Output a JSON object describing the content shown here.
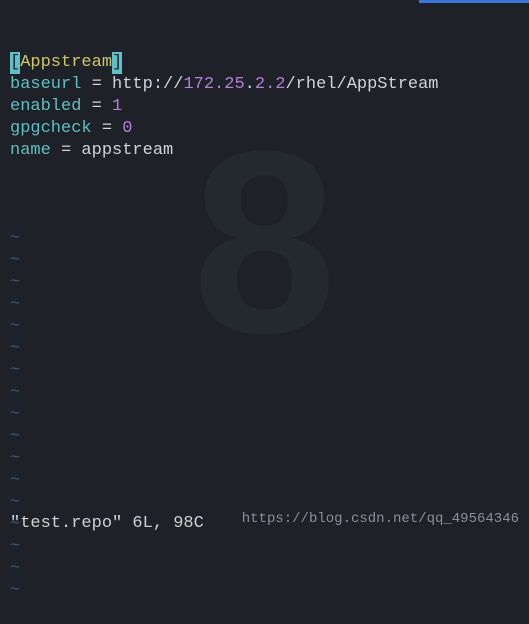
{
  "editor": {
    "lines": [
      {
        "parts": [
          {
            "cls": "cursor-block",
            "text": "["
          },
          {
            "cls": "yellow",
            "text": "Appstream"
          },
          {
            "cls": "cursor-block",
            "text": "]"
          }
        ]
      },
      {
        "parts": [
          {
            "cls": "teal",
            "text": "baseurl"
          },
          {
            "cls": "white",
            "text": " = http://"
          },
          {
            "cls": "purple",
            "text": "172.25"
          },
          {
            "cls": "white",
            "text": "."
          },
          {
            "cls": "purple",
            "text": "2.2"
          },
          {
            "cls": "white",
            "text": "/rhel/AppStream"
          }
        ]
      },
      {
        "parts": [
          {
            "cls": "teal",
            "text": "enabled"
          },
          {
            "cls": "white",
            "text": " = "
          },
          {
            "cls": "purple",
            "text": "1"
          }
        ]
      },
      {
        "parts": [
          {
            "cls": "teal",
            "text": "gpgcheck"
          },
          {
            "cls": "white",
            "text": " = "
          },
          {
            "cls": "purple",
            "text": "0"
          }
        ]
      },
      {
        "parts": [
          {
            "cls": "teal",
            "text": "name"
          },
          {
            "cls": "white",
            "text": " = appstream"
          }
        ]
      }
    ],
    "tilde": "~",
    "tilde_count": 17
  },
  "status": "\"test.repo\" 6L, 98C",
  "watermark_url": "https://blog.csdn.net/qq_49564346",
  "bg_watermark": "8"
}
